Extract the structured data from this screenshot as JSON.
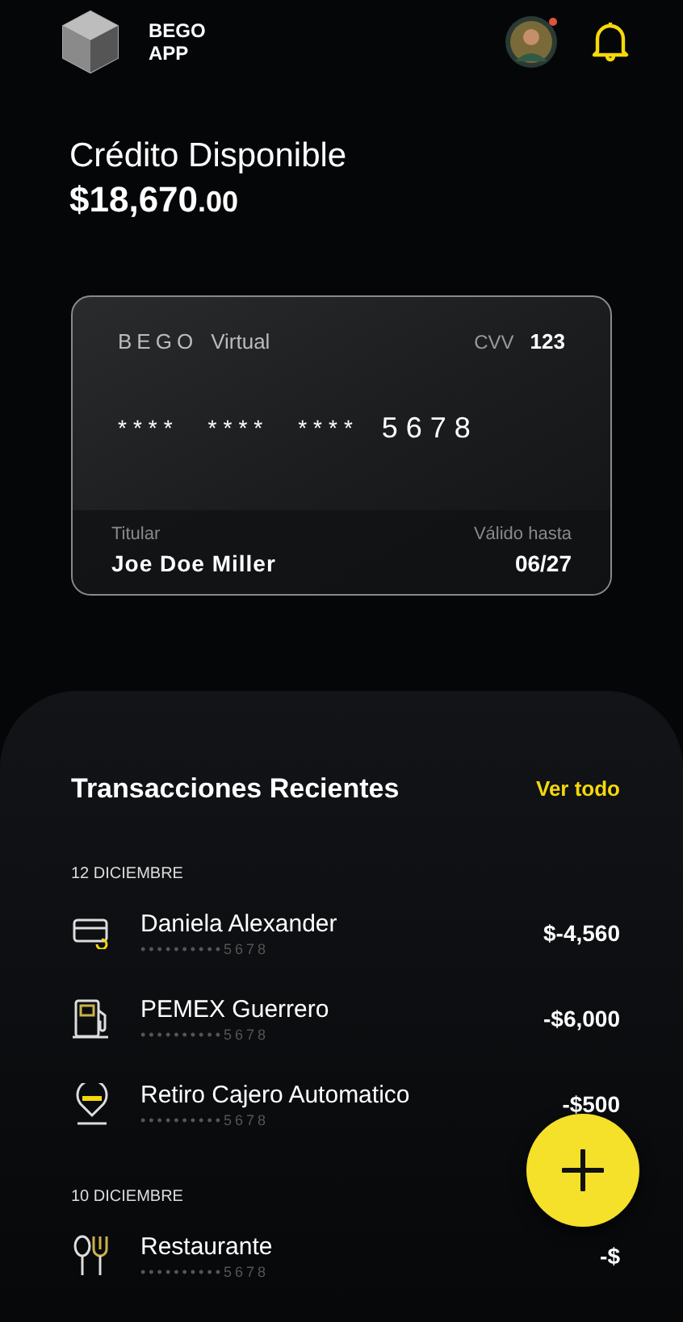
{
  "app": {
    "name_line1": "BEGO",
    "name_line2": "APP",
    "has_notification": true
  },
  "credit": {
    "label": "Crédito Disponible",
    "amount": "$18,670",
    "cents": ".00"
  },
  "card": {
    "brand": "BEGO",
    "type": "Virtual",
    "cvv_label": "CVV",
    "cvv": "123",
    "number_groups": [
      "****",
      "****",
      "****"
    ],
    "last4": "5678",
    "holder_label": "Titular",
    "holder": "Joe Doe Miller",
    "expiry_label": "Válido hasta",
    "expiry": "06/27"
  },
  "transactions": {
    "title": "Transacciones Recientes",
    "see_all": "Ver todo",
    "groups": [
      {
        "date": "12 DICIEMBRE",
        "items": [
          {
            "kind": "card",
            "name": "Daniela Alexander",
            "account": "••••••••••5678",
            "amount": "$-4,560"
          },
          {
            "kind": "fuel",
            "name": "PEMEX Guerrero",
            "account": "••••••••••5678",
            "amount": "-$6,000"
          },
          {
            "kind": "atm",
            "name": "Retiro Cajero Automatico",
            "account": "••••••••••5678",
            "amount": "-$500"
          }
        ]
      },
      {
        "date": "10 DICIEMBRE",
        "items": [
          {
            "kind": "food",
            "name": "Restaurante",
            "account": "••••••••••5678",
            "amount": "-$"
          }
        ]
      }
    ]
  }
}
